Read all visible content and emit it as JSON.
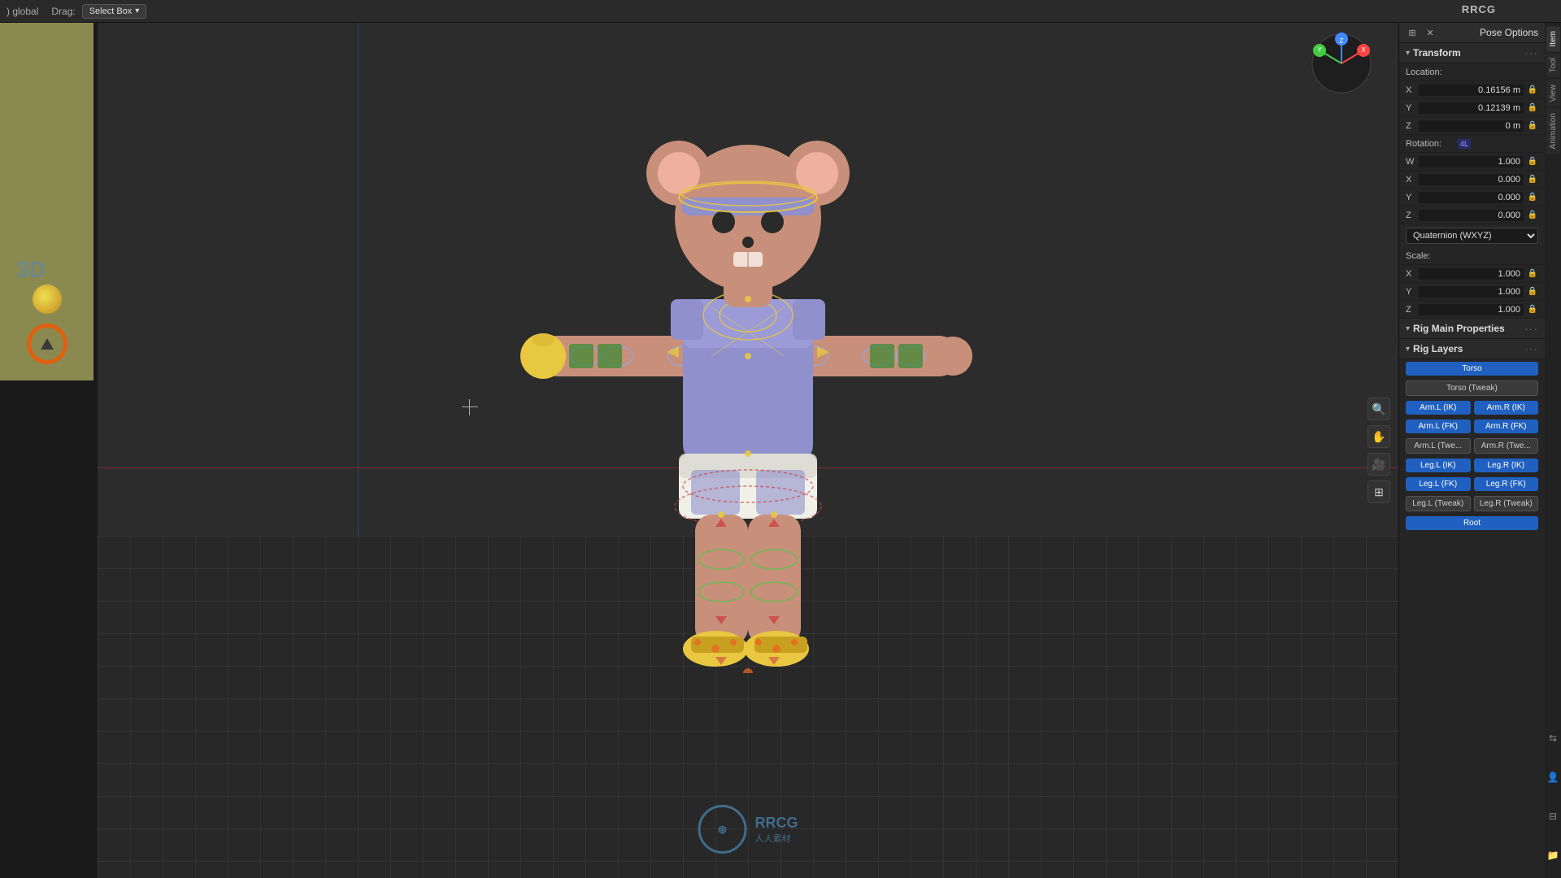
{
  "app": {
    "title": "RRCG",
    "mode": ") global",
    "drag_label": "Drag:",
    "select_box": "Select Box"
  },
  "header": {
    "pose_options": "Pose Options",
    "icon_grid": "⊞",
    "icon_close": "✕"
  },
  "right_tabs": [
    {
      "id": "item",
      "label": "Item"
    },
    {
      "id": "tool",
      "label": "Tool"
    },
    {
      "id": "view",
      "label": "View"
    },
    {
      "id": "animation",
      "label": "Animation"
    }
  ],
  "transform": {
    "section_title": "Transform",
    "location_label": "Location:",
    "x_label": "X",
    "y_label": "Y",
    "z_label": "Z",
    "loc_x": "0.16156 m",
    "loc_y": "0.12139 m",
    "loc_z": "0 m",
    "rotation_label": "Rotation:",
    "rotation_badge": "4L",
    "rot_w": "1.000",
    "rot_x": "0.000",
    "rot_y": "0.000",
    "rot_z": "0.000",
    "quaternion_label": "Quaternion (WXYZ)",
    "scale_label": "Scale:",
    "scale_x": "1.000",
    "scale_y": "1.000",
    "scale_z": "1.000"
  },
  "rig": {
    "main_props_title": "Rig Main Properties",
    "layers_title": "Rig Layers",
    "buttons": [
      {
        "label": "Torso",
        "style": "blue",
        "full": true
      },
      {
        "label": "Torso (Tweak)",
        "style": "gray",
        "full": true
      },
      {
        "label": "Arm.L (IK)",
        "style": "blue"
      },
      {
        "label": "Arm.R (IK)",
        "style": "blue"
      },
      {
        "label": "Arm.L (FK)",
        "style": "blue"
      },
      {
        "label": "Arm.R (FK)",
        "style": "blue"
      },
      {
        "label": "Arm.L (Twe...",
        "style": "gray"
      },
      {
        "label": "Arm.R (Twe...",
        "style": "gray"
      },
      {
        "label": "Leg.L (IK)",
        "style": "blue"
      },
      {
        "label": "Leg.R (IK)",
        "style": "blue"
      },
      {
        "label": "Leg.L (FK)",
        "style": "blue"
      },
      {
        "label": "Leg.R (FK)",
        "style": "blue"
      },
      {
        "label": "Leg.L (Tweak)",
        "style": "gray"
      },
      {
        "label": "Leg.R (Tweak)",
        "style": "gray"
      },
      {
        "label": "Root",
        "style": "blue",
        "full": true
      }
    ]
  },
  "watermark": {
    "logo": "RRCG",
    "sub": "人人素材"
  },
  "colors": {
    "blue_accent": "#2060c0",
    "bg_dark": "#1a1a1a",
    "bg_mid": "#252525",
    "bg_light": "#2d2d2d",
    "grid_color": "#3a3a3a",
    "character_body": "#c8907a",
    "character_outfit": "#9090cc",
    "character_headband": "#9090cc",
    "rig_yellow": "#e8c840",
    "rig_red": "#cc4040",
    "rig_green": "#40cc40",
    "rig_blue": "#4040cc"
  }
}
